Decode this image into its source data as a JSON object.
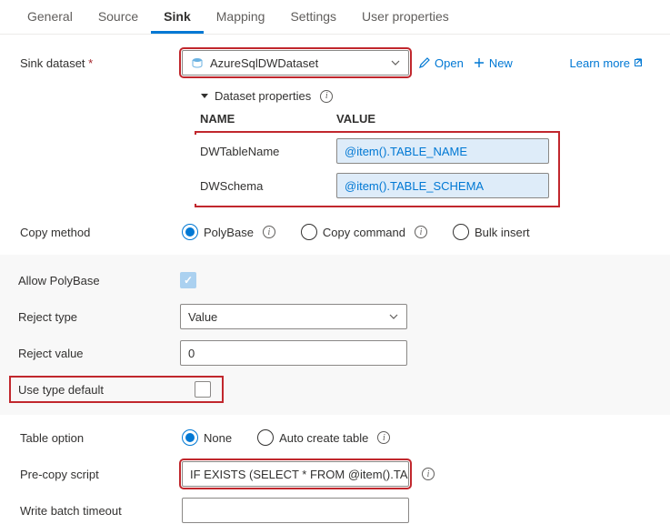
{
  "tabs": [
    "General",
    "Source",
    "Sink",
    "Mapping",
    "Settings",
    "User properties"
  ],
  "activeTab": "Sink",
  "sinkDataset": {
    "label": "Sink dataset",
    "value": "AzureSqlDWDataset",
    "open": "Open",
    "new": "New",
    "learnMore": "Learn more"
  },
  "datasetProps": {
    "header": "Dataset properties",
    "nameCol": "NAME",
    "valueCol": "VALUE",
    "rows": [
      {
        "name": "DWTableName",
        "value": "@item().TABLE_NAME"
      },
      {
        "name": "DWSchema",
        "value": "@item().TABLE_SCHEMA"
      }
    ]
  },
  "copyMethod": {
    "label": "Copy method",
    "options": [
      "PolyBase",
      "Copy command",
      "Bulk insert"
    ],
    "selected": "PolyBase"
  },
  "polybase": {
    "allowLabel": "Allow PolyBase",
    "allowChecked": true,
    "rejectTypeLabel": "Reject type",
    "rejectTypeValue": "Value",
    "rejectValueLabel": "Reject value",
    "rejectValue": "0",
    "useTypeDefaultLabel": "Use type default",
    "useTypeDefaultChecked": false
  },
  "tableOption": {
    "label": "Table option",
    "options": [
      "None",
      "Auto create table"
    ],
    "selected": "None"
  },
  "preCopy": {
    "label": "Pre-copy script",
    "value": "IF EXISTS (SELECT * FROM  @item().TA…"
  },
  "writeBatch": {
    "label": "Write batch timeout",
    "value": ""
  }
}
